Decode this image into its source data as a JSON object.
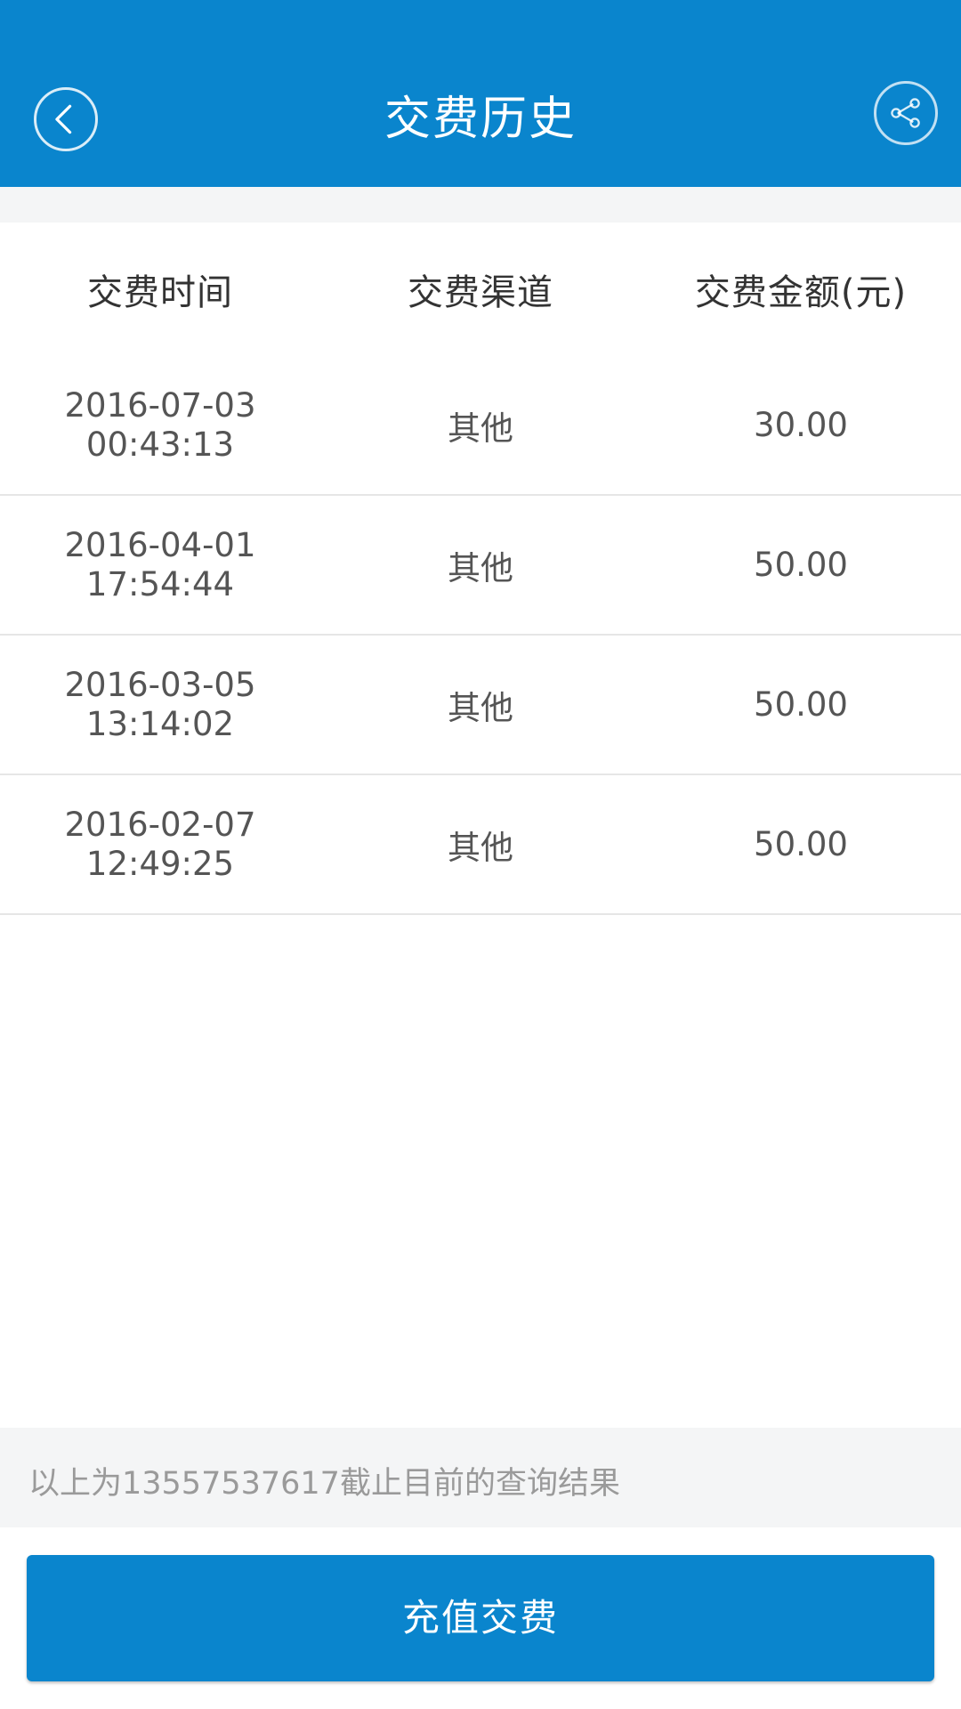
{
  "header": {
    "title": "交费历史",
    "back_icon": "chevron-left-icon",
    "share_icon": "share-icon"
  },
  "table": {
    "columns": [
      "交费时间",
      "交费渠道",
      "交费金额(元)"
    ],
    "rows": [
      {
        "date": "2016-07-03",
        "time": "00:43:13",
        "channel": "其他",
        "amount": "30.00"
      },
      {
        "date": "2016-04-01",
        "time": "17:54:44",
        "channel": "其他",
        "amount": "50.00"
      },
      {
        "date": "2016-03-05",
        "time": "13:14:02",
        "channel": "其他",
        "amount": "50.00"
      },
      {
        "date": "2016-02-07",
        "time": "12:49:25",
        "channel": "其他",
        "amount": "50.00"
      }
    ]
  },
  "footer": {
    "note": "以上为13557537617截止目前的查询结果",
    "button_label": "充值交费"
  },
  "colors": {
    "brand": "#0a85cd",
    "background_band": "#f4f5f6"
  }
}
